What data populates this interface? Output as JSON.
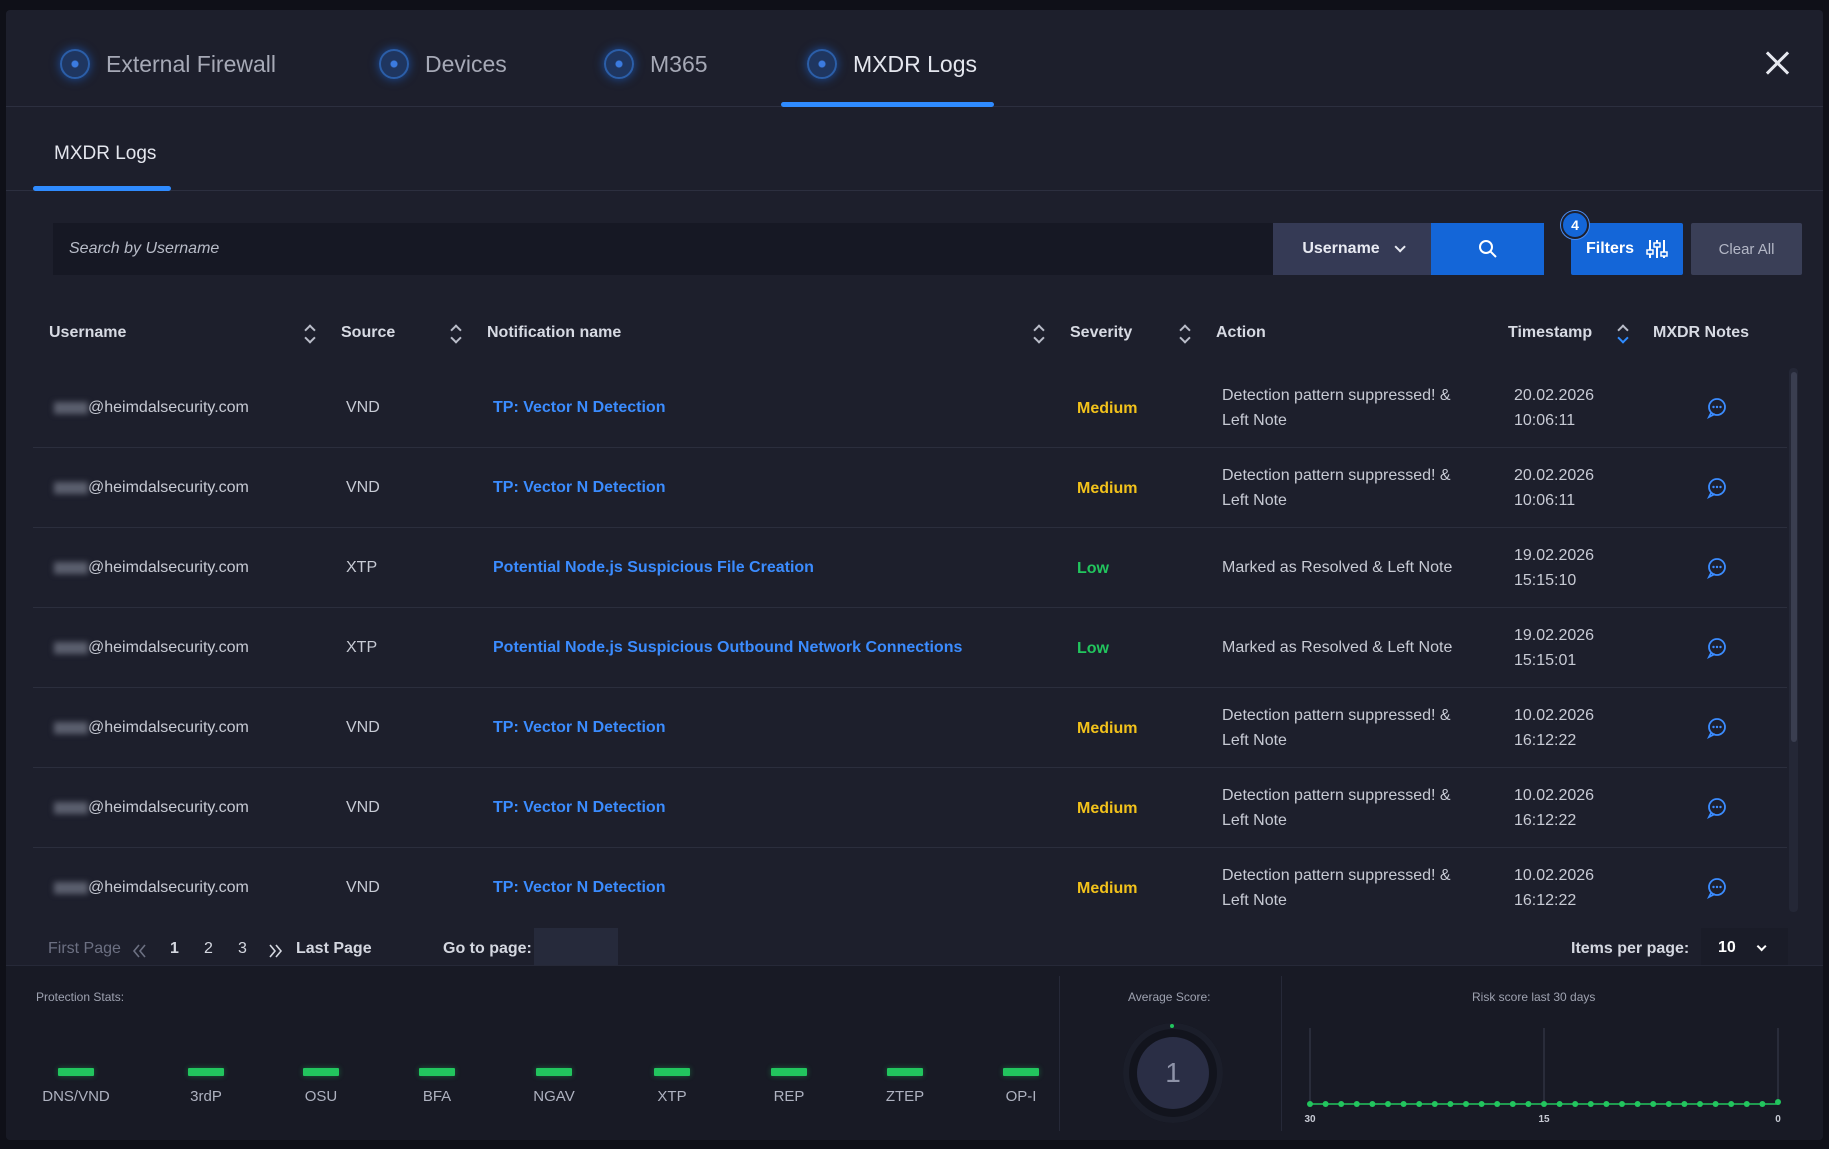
{
  "top_tabs": [
    {
      "label": "External Firewall",
      "active": false
    },
    {
      "label": "Devices",
      "active": false
    },
    {
      "label": "M365",
      "active": false
    },
    {
      "label": "MXDR Logs",
      "active": true
    }
  ],
  "sub_tab": {
    "label": "MXDR Logs"
  },
  "search": {
    "placeholder": "Search by Username",
    "field_select": "Username",
    "filters_label": "Filters",
    "filters_count": "4",
    "clear_all_label": "Clear All"
  },
  "table": {
    "columns": [
      "Username",
      "Source",
      "Notification name",
      "Severity",
      "Action",
      "Timestamp",
      "MXDR Notes"
    ],
    "rows": [
      {
        "username": "@heimdalsecurity.com",
        "source": "VND",
        "notification": "TP: Vector N Detection",
        "severity": "Medium",
        "action": "Detection pattern suppressed! & Left Note",
        "date": "20.02.2026",
        "time": "10:06:11"
      },
      {
        "username": "@heimdalsecurity.com",
        "source": "VND",
        "notification": "TP: Vector N Detection",
        "severity": "Medium",
        "action": "Detection pattern suppressed! & Left Note",
        "date": "20.02.2026",
        "time": "10:06:11"
      },
      {
        "username": "@heimdalsecurity.com",
        "source": "XTP",
        "notification": "Potential Node.js Suspicious File Creation",
        "severity": "Low",
        "action": "Marked as Resolved & Left Note",
        "date": "19.02.2026",
        "time": "15:15:10"
      },
      {
        "username": "@heimdalsecurity.com",
        "source": "XTP",
        "notification": "Potential Node.js Suspicious Outbound Network Connections",
        "severity": "Low",
        "action": "Marked as Resolved & Left Note",
        "date": "19.02.2026",
        "time": "15:15:01"
      },
      {
        "username": "@heimdalsecurity.com",
        "source": "VND",
        "notification": "TP: Vector N Detection",
        "severity": "Medium",
        "action": "Detection pattern suppressed! & Left Note",
        "date": "10.02.2026",
        "time": "16:12:22"
      },
      {
        "username": "@heimdalsecurity.com",
        "source": "VND",
        "notification": "TP: Vector N Detection",
        "severity": "Medium",
        "action": "Detection pattern suppressed! & Left Note",
        "date": "10.02.2026",
        "time": "16:12:22"
      },
      {
        "username": "@heimdalsecurity.com",
        "source": "VND",
        "notification": "TP: Vector N Detection",
        "severity": "Medium",
        "action": "Detection pattern suppressed! & Left Note",
        "date": "10.02.2026",
        "time": "16:12:22"
      }
    ]
  },
  "pagination": {
    "first_page": "First Page",
    "pages": [
      "1",
      "2",
      "3"
    ],
    "current_page": "1",
    "last_page": "Last Page",
    "goto_label": "Go to page:",
    "items_per_page_label": "Items per page:",
    "items_per_page": "10"
  },
  "stats": {
    "protection_title": "Protection Stats:",
    "protection_items": [
      "DNS/VND",
      "3rdP",
      "OSU",
      "BFA",
      "NGAV",
      "XTP",
      "REP",
      "ZTEP",
      "OP-I"
    ],
    "average_title": "Average Score:",
    "average_score": "1",
    "risk_title": "Risk score last 30 days",
    "risk_axis_labels": [
      "30",
      "15",
      "0"
    ],
    "colors": {
      "good": "#22c55e",
      "medium": "#f2c21b",
      "accent": "#1466d8"
    }
  }
}
